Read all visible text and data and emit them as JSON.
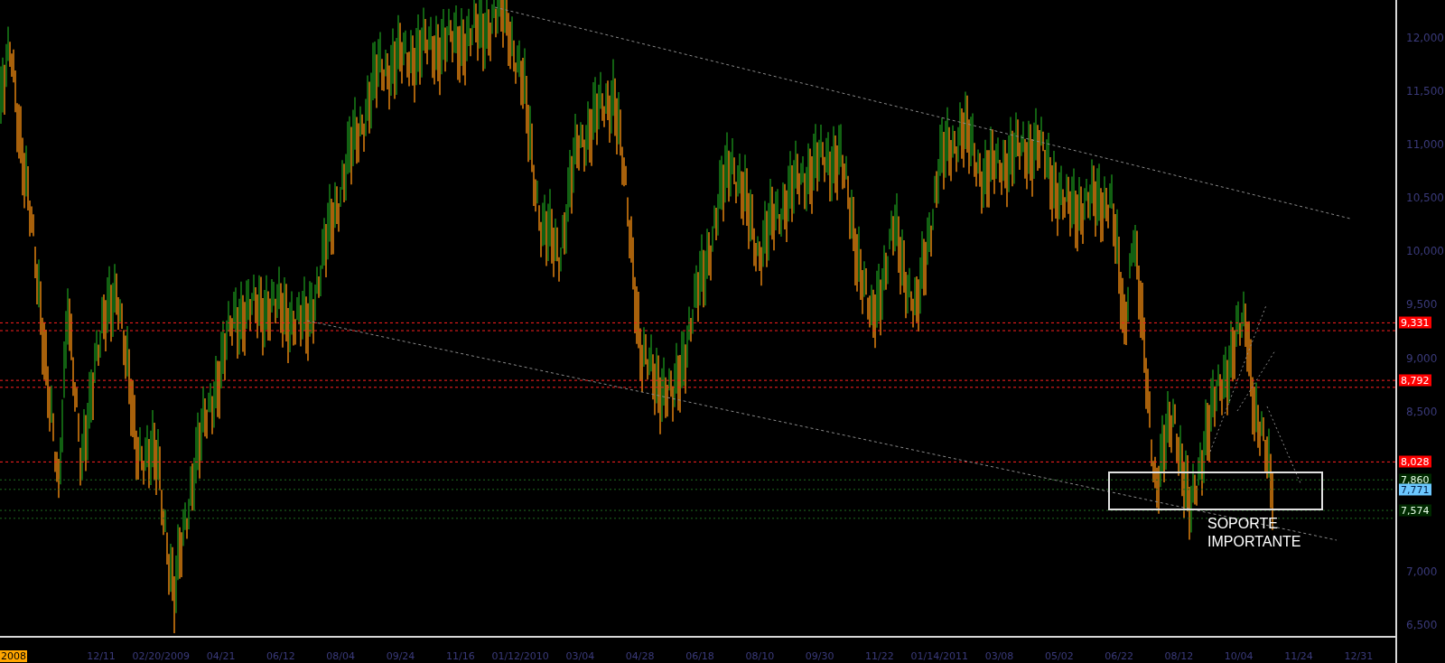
{
  "chart": {
    "y_axis": {
      "ticks": [
        "12,000",
        "11,500",
        "11,000",
        "10,500",
        "10,000",
        "9,500",
        "9,000",
        "8,500",
        "7,000",
        "6,500"
      ]
    },
    "levels": [
      {
        "label": "9,331",
        "kind": "resistance"
      },
      {
        "label": "8,792",
        "kind": "resistance"
      },
      {
        "label": "8,028",
        "kind": "resistance"
      },
      {
        "label": "7,860",
        "kind": "support"
      },
      {
        "label": "7,771",
        "kind": "last"
      },
      {
        "label": "7,574",
        "kind": "support"
      }
    ],
    "x_axis": {
      "labels": [
        {
          "text": "2008",
          "kind": "badge"
        },
        {
          "text": "12/11",
          "kind": "date"
        },
        {
          "text": "02/20/2009",
          "kind": "date"
        },
        {
          "text": "04/21",
          "kind": "date"
        },
        {
          "text": "06/12",
          "kind": "date"
        },
        {
          "text": "08/04",
          "kind": "date"
        },
        {
          "text": "09/24",
          "kind": "date"
        },
        {
          "text": "11/16",
          "kind": "date"
        },
        {
          "text": "01/12/2010",
          "kind": "date"
        },
        {
          "text": "03/04",
          "kind": "date"
        },
        {
          "text": "04/28",
          "kind": "date"
        },
        {
          "text": "06/18",
          "kind": "date"
        },
        {
          "text": "08/10",
          "kind": "date"
        },
        {
          "text": "09/30",
          "kind": "date"
        },
        {
          "text": "11/22",
          "kind": "date"
        },
        {
          "text": "01/14/2011",
          "kind": "date"
        },
        {
          "text": "03/08",
          "kind": "date"
        },
        {
          "text": "05/02",
          "kind": "date"
        },
        {
          "text": "06/22",
          "kind": "date"
        },
        {
          "text": "08/12",
          "kind": "date"
        },
        {
          "text": "10/04",
          "kind": "date"
        },
        {
          "text": "11/24",
          "kind": "date"
        },
        {
          "text": "12/31",
          "kind": "date"
        }
      ]
    },
    "annotation": {
      "text": "SOPORTE IMPORTANTE"
    }
  }
}
